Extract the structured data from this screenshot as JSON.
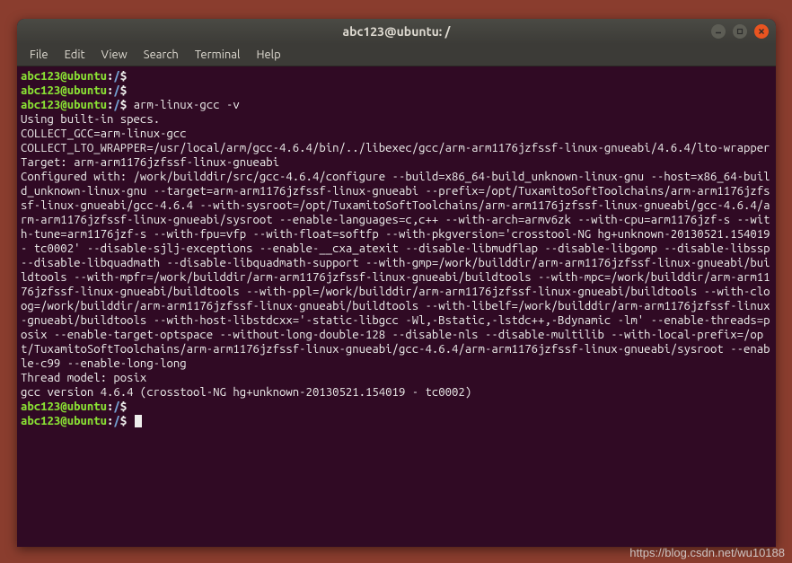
{
  "window": {
    "title": "abc123@ubuntu: /"
  },
  "menubar": {
    "items": [
      "File",
      "Edit",
      "View",
      "Search",
      "Terminal",
      "Help"
    ]
  },
  "prompt": {
    "user_host": "abc123@ubuntu",
    "path": "/",
    "sep": ":",
    "symbol": "$"
  },
  "commands": {
    "cmd1": "arm-linux-gcc -v"
  },
  "output": {
    "line1": "Using built-in specs.",
    "line2": "COLLECT_GCC=arm-linux-gcc",
    "line3": "COLLECT_LTO_WRAPPER=/usr/local/arm/gcc-4.6.4/bin/../libexec/gcc/arm-arm1176jzfssf-linux-gnueabi/4.6.4/lto-wrapper",
    "line4": "Target: arm-arm1176jzfssf-linux-gnueabi",
    "line5": "Configured with: /work/builddir/src/gcc-4.6.4/configure --build=x86_64-build_unknown-linux-gnu --host=x86_64-build_unknown-linux-gnu --target=arm-arm1176jzfssf-linux-gnueabi --prefix=/opt/TuxamitoSoftToolchains/arm-arm1176jzfssf-linux-gnueabi/gcc-4.6.4 --with-sysroot=/opt/TuxamitoSoftToolchains/arm-arm1176jzfssf-linux-gnueabi/gcc-4.6.4/arm-arm1176jzfssf-linux-gnueabi/sysroot --enable-languages=c,c++ --with-arch=armv6zk --with-cpu=arm1176jzf-s --with-tune=arm1176jzf-s --with-fpu=vfp --with-float=softfp --with-pkgversion='crosstool-NG hg+unknown-20130521.154019 - tc0002' --disable-sjlj-exceptions --enable-__cxa_atexit --disable-libmudflap --disable-libgomp --disable-libssp --disable-libquadmath --disable-libquadmath-support --with-gmp=/work/builddir/arm-arm1176jzfssf-linux-gnueabi/buildtools --with-mpfr=/work/builddir/arm-arm1176jzfssf-linux-gnueabi/buildtools --with-mpc=/work/builddir/arm-arm1176jzfssf-linux-gnueabi/buildtools --with-ppl=/work/builddir/arm-arm1176jzfssf-linux-gnueabi/buildtools --with-cloog=/work/builddir/arm-arm1176jzfssf-linux-gnueabi/buildtools --with-libelf=/work/builddir/arm-arm1176jzfssf-linux-gnueabi/buildtools --with-host-libstdcxx='-static-libgcc -Wl,-Bstatic,-lstdc++,-Bdynamic -lm' --enable-threads=posix --enable-target-optspace --without-long-double-128 --disable-nls --disable-multilib --with-local-prefix=/opt/TuxamitoSoftToolchains/arm-arm1176jzfssf-linux-gnueabi/gcc-4.6.4/arm-arm1176jzfssf-linux-gnueabi/sysroot --enable-c99 --enable-long-long",
    "line6": "Thread model: posix",
    "line7": "gcc version 4.6.4 (crosstool-NG hg+unknown-20130521.154019 - tc0002)"
  },
  "watermark": "https://blog.csdn.net/wu10188"
}
